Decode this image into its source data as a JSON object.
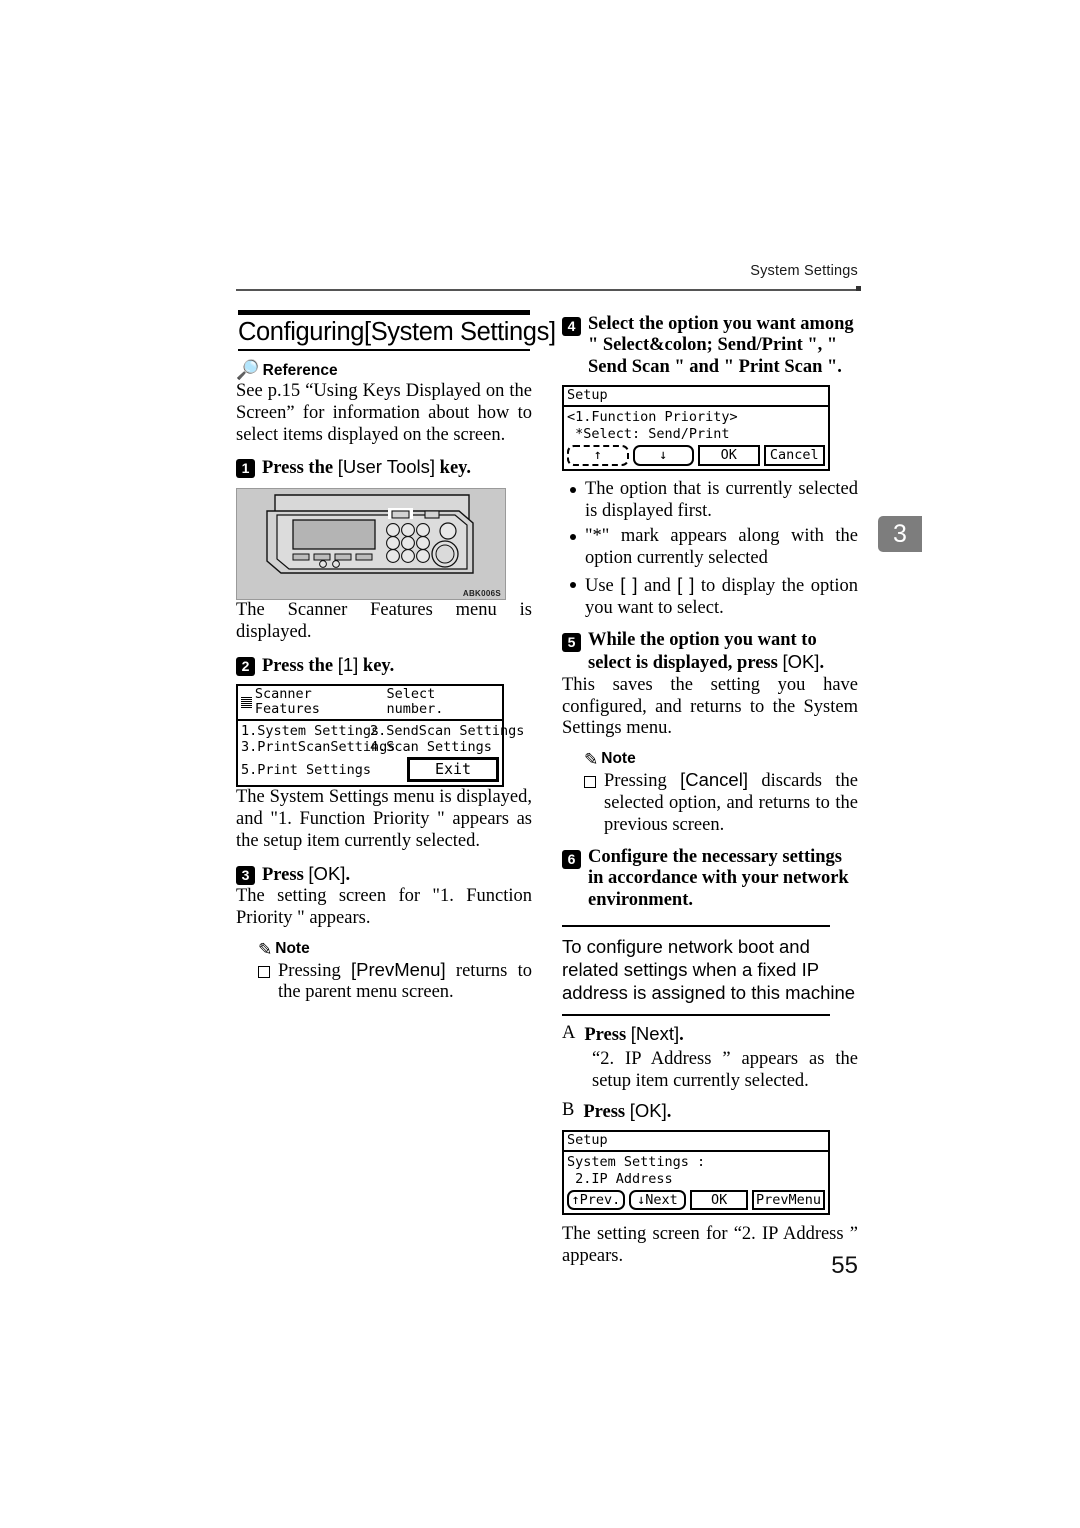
{
  "header": {
    "running_head": "System Settings"
  },
  "chapter_tab": {
    "number": "3"
  },
  "folio": {
    "page_number": "55"
  },
  "left_column": {
    "section_title": "Configuring[System Settings]",
    "reference_label": "Reference",
    "reference_text": "See p.15 “Using Keys Displayed on the Screen” for information about how to select items displayed on the screen.",
    "step1": {
      "number": "1",
      "text_before": "Press the ",
      "key": "[User Tools]",
      "text_after": " key."
    },
    "illustration_caption": "ABK006S",
    "after_step1_text": "The Scanner Features menu is displayed.",
    "step2": {
      "number": "2",
      "text_before": "Press the ",
      "key": "[1]",
      "text_after": " key."
    },
    "after_step2_text": "The System Settings menu is displayed, and \"1. Function Priority \" appears as the setup item currently selected.",
    "step3": {
      "number": "3",
      "text_before": "Press ",
      "key": "[OK]",
      "text_after": "."
    },
    "after_step3_text": "The setting screen for \"1. Function Priority \" appears.",
    "note_label": "Note",
    "note_text_before": "Pressing ",
    "note_key": "[PrevMenu]",
    "note_text_after": " returns to the parent menu screen."
  },
  "right_column": {
    "step4": {
      "number": "4",
      "text": "Select the option you want among \" Select&colon; Send/Print \", \" Send Scan \" and \" Print Scan \"."
    },
    "bullets": [
      {
        "text": "The option that is currently selected is displayed first."
      },
      {
        "text": "\"*\" mark appears along with the option currently selected"
      },
      {
        "text_before": "Use ",
        "key1": "[ ]",
        "text_mid": " and ",
        "key2": "[ ]",
        "text_after": " to display the option you want to select."
      }
    ],
    "step5": {
      "number": "5",
      "text_before": "While the option you want to select is displayed, press ",
      "key": "[OK]",
      "text_after": "."
    },
    "after_step5_text": "This saves the setting you have configured, and returns to the System Settings menu.",
    "note_label": "Note",
    "note_text_before": "Pressing ",
    "note_key": "[Cancel]",
    "note_text_after": " discards the selected option, and returns to the previous screen.",
    "step6": {
      "number": "6",
      "text": "Configure the necessary settings in accordance with your network environment."
    },
    "sub_section_heading": "To configure network boot and related settings when a fixed IP address is assigned to this machine",
    "sub_step_a": {
      "letter": "A",
      "text_before": "Press ",
      "key": "[Next]",
      "text_after": "."
    },
    "sub_step_a_body": "“2. IP Address ” appears as the setup item currently selected.",
    "sub_step_b": {
      "letter": "B",
      "text_before": "Press ",
      "key": "[OK]",
      "text_after": "."
    },
    "final_text": "The setting screen for “2. IP Address ” appears."
  },
  "lcd_scanner_features": {
    "title": "Scanner Features",
    "title_right": "Select number.",
    "icon": "scanner-icon",
    "items": [
      "1.System Settings",
      "2.SendScan Settings",
      "3.PrintScanSettings",
      "4.Scan Settings",
      "5.Print Settings"
    ],
    "exit_button": "Exit"
  },
  "lcd_setup_function_priority": {
    "title": "Setup",
    "line1": "<1.Function Priority>",
    "line2": " *Select: Send/Print",
    "buttons": [
      "↑",
      "↓",
      "OK",
      "Cancel"
    ]
  },
  "lcd_setup_ip_address": {
    "title": "Setup",
    "line1": "System Settings :",
    "line2": " 2.IP Address",
    "buttons": [
      "↑Prev.",
      "↓Next",
      "OK",
      "PrevMenu"
    ]
  }
}
